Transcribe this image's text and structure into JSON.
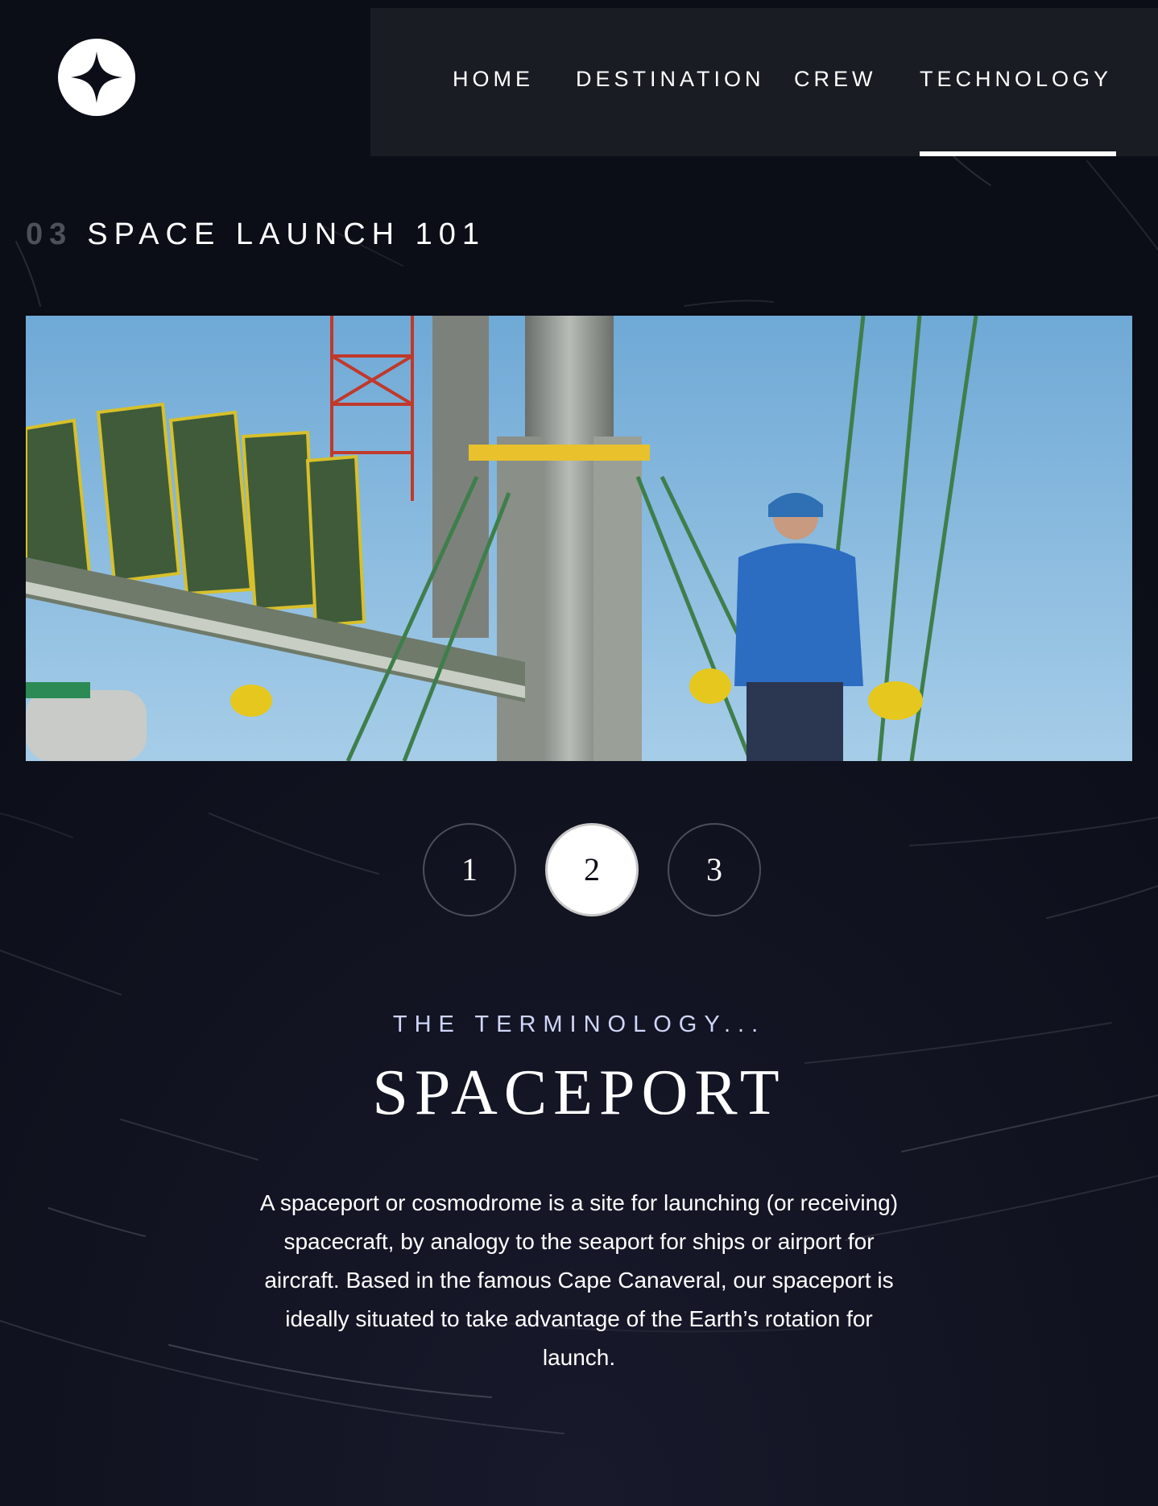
{
  "colors": {
    "background": "#0b0d17",
    "nav_background": "#1b1d24",
    "accent_light": "#d0d6f9",
    "white": "#ffffff"
  },
  "header": {
    "logo_icon": "four-point-star-icon",
    "nav": [
      {
        "label": "HOME"
      },
      {
        "label": "DESTINATION"
      },
      {
        "label": "CREW"
      },
      {
        "label": "TECHNOLOGY",
        "active": true
      }
    ]
  },
  "page": {
    "number": "03",
    "title": "SPACE LAUNCH 101"
  },
  "pager": {
    "items": [
      "1",
      "2",
      "3"
    ],
    "active_index": 1
  },
  "content": {
    "eyebrow": "THE TERMINOLOGY...",
    "term": "SPACEPORT",
    "description": "A spaceport or cosmodrome is a site for launching (or receiving) spacecraft, by analogy to the seaport for ships or airport for aircraft. Based in the famous Cape Canaveral, our spaceport is ideally situated to take advantage of the Earth’s rotation for launch."
  }
}
